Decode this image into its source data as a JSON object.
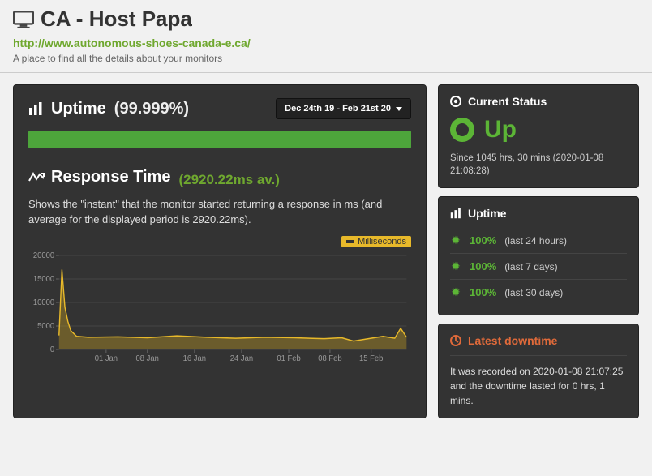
{
  "header": {
    "title": "CA - Host Papa",
    "url": "http://www.autonomous-shoes-canada-e.ca/",
    "subtitle": "A place to find all the details about your monitors"
  },
  "uptime_section": {
    "title": "Uptime",
    "percentage": "(99.999%)",
    "date_range": "Dec 24th 19 - Feb 21st 20"
  },
  "response_section": {
    "title": "Response Time",
    "avg_label": "(2920.22ms av.)",
    "description": "Shows the \"instant\" that the monitor started returning a response in ms (and average for the displayed period is 2920.22ms).",
    "legend": "Milliseconds"
  },
  "status_card": {
    "heading": "Current Status",
    "state": "Up",
    "since": "Since 1045 hrs, 30 mins (2020-01-08 21:08:28)"
  },
  "uptime_card": {
    "heading": "Uptime",
    "items": [
      {
        "pct": "100%",
        "range": "(last 24 hours)"
      },
      {
        "pct": "100%",
        "range": "(last 7 days)"
      },
      {
        "pct": "100%",
        "range": "(last 30 days)"
      }
    ]
  },
  "downtime_card": {
    "heading": "Latest downtime",
    "text": "It was recorded on 2020-01-08 21:07:25 and the downtime lasted for 0 hrs, 1 mins."
  },
  "chart_data": {
    "type": "area",
    "title": "",
    "xlabel": "",
    "ylabel": "",
    "ylim": [
      0,
      20000
    ],
    "yticks": [
      0,
      5000,
      10000,
      15000,
      20000
    ],
    "categories": [
      "01 Jan",
      "08 Jan",
      "16 Jan",
      "24 Jan",
      "01 Feb",
      "08 Feb",
      "15 Feb"
    ],
    "legend": [
      "Milliseconds"
    ],
    "series": [
      {
        "name": "Milliseconds",
        "x": [
          0,
          0.5,
          1,
          1.5,
          2,
          3,
          5,
          10,
          15,
          20,
          25,
          30,
          35,
          40,
          45,
          48,
          50,
          52,
          55,
          57,
          58,
          59
        ],
        "values": [
          3000,
          17000,
          9000,
          6000,
          4000,
          2800,
          2600,
          2700,
          2500,
          2900,
          2600,
          2400,
          2600,
          2500,
          2300,
          2500,
          1800,
          2200,
          2800,
          2400,
          4500,
          2600
        ]
      }
    ],
    "x_domain": [
      0,
      59
    ]
  }
}
